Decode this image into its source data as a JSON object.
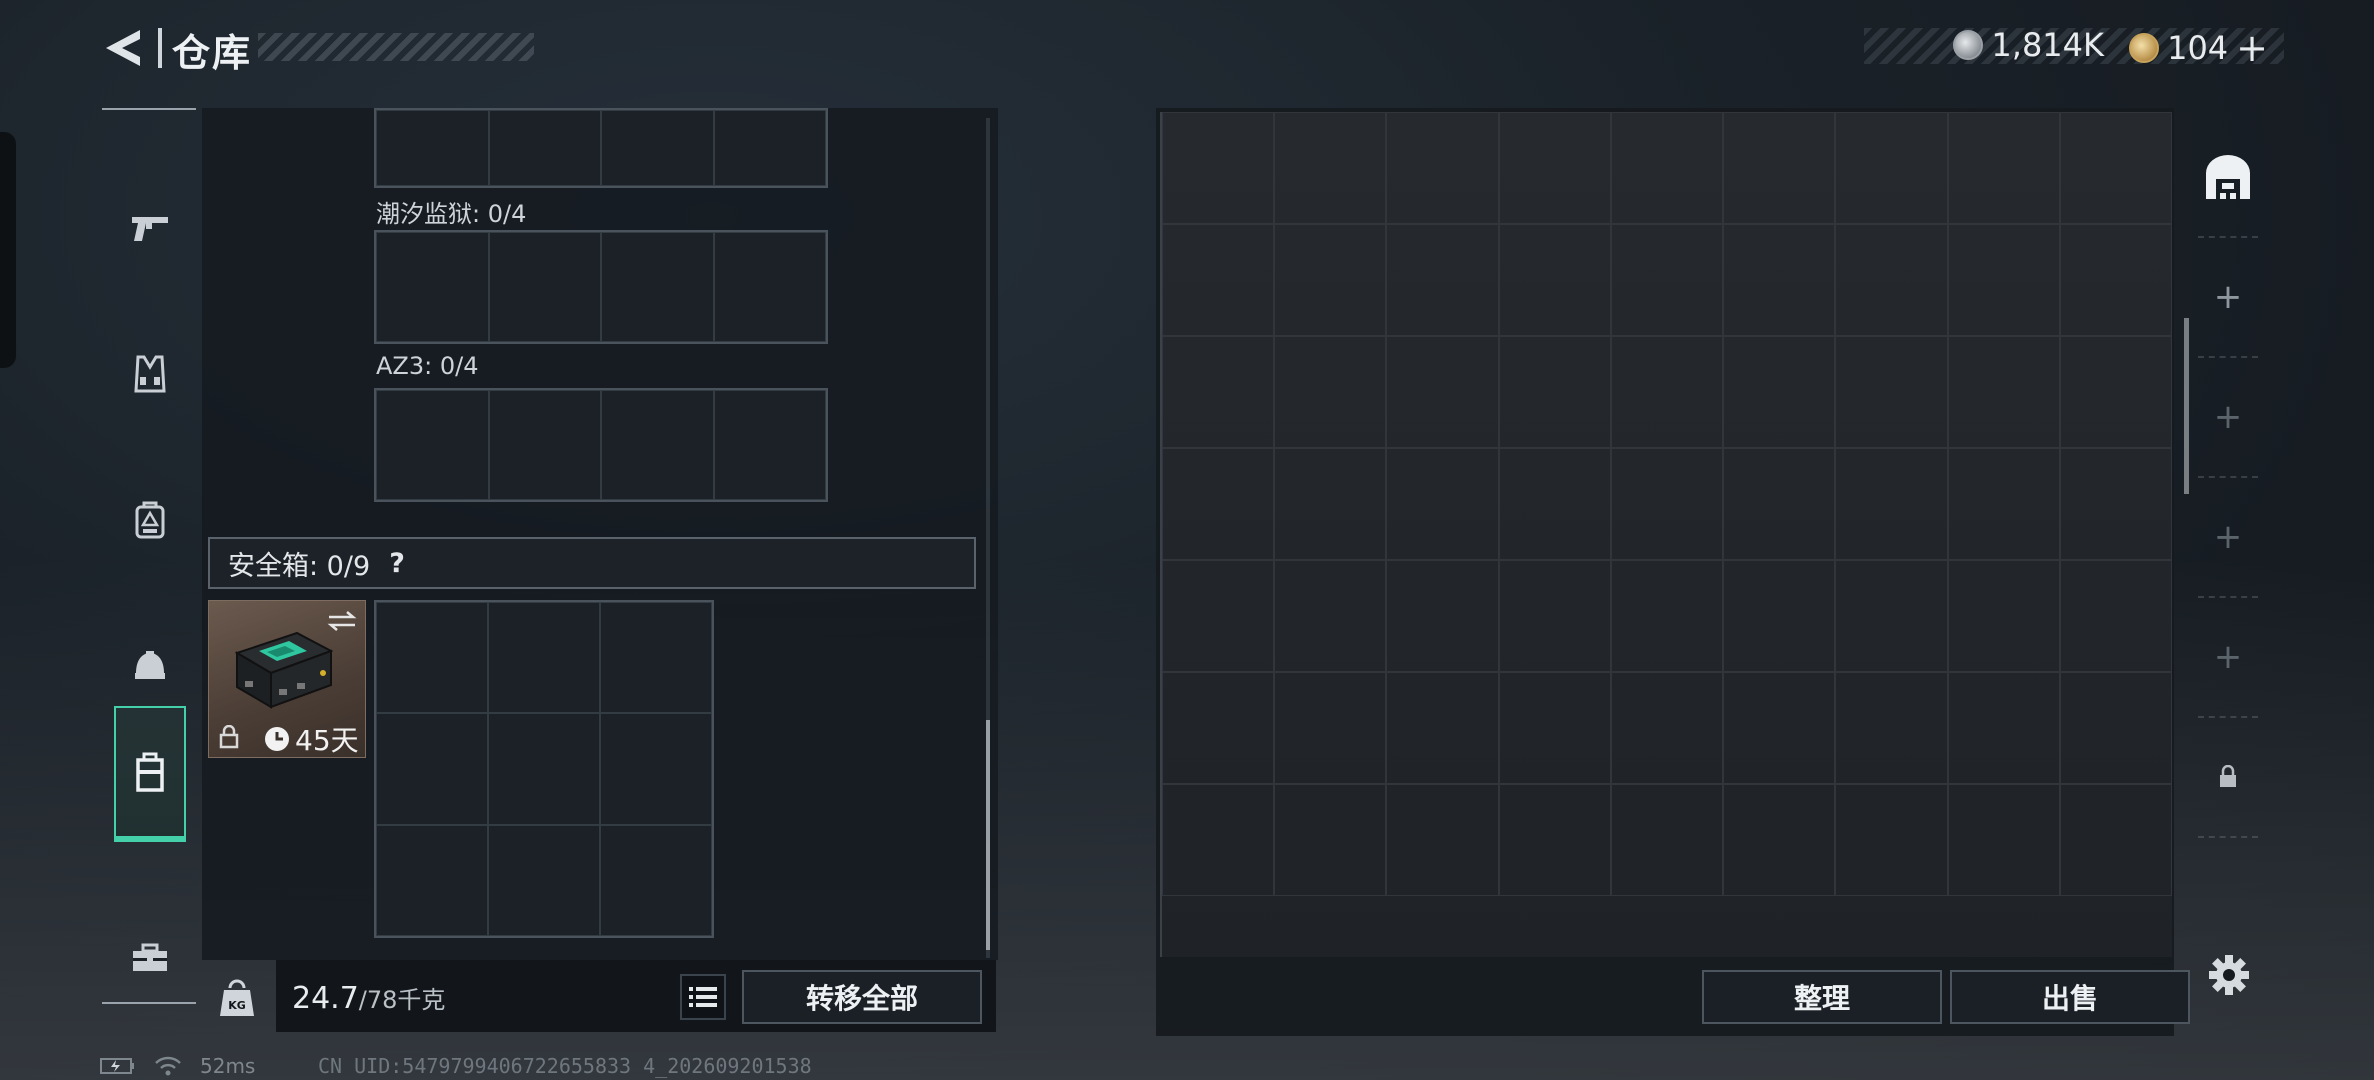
{
  "header": {
    "title": "仓库",
    "currencies": [
      {
        "icon": "silver-coin-icon",
        "value": "1,814K"
      },
      {
        "icon": "gold-coin-icon",
        "value": "104"
      }
    ],
    "add_label": "+"
  },
  "left_nav": {
    "items": [
      {
        "name": "weapon",
        "icon": "pistol-icon"
      },
      {
        "name": "armor",
        "icon": "vest-icon"
      },
      {
        "name": "backpack",
        "icon": "backpack-icon"
      },
      {
        "name": "helmet",
        "icon": "helmet-icon"
      },
      {
        "name": "safebox",
        "icon": "case-icon",
        "active": true
      },
      {
        "name": "toolbox",
        "icon": "toolbox-icon"
      }
    ]
  },
  "slots": [
    {
      "label": "潮汐监狱: 0/4"
    },
    {
      "label": "AZ3: 0/4"
    }
  ],
  "safebox": {
    "label": "安全箱: 0/9",
    "help": "?",
    "item": {
      "days": "45天",
      "icon": "secure-case-icon"
    }
  },
  "footer": {
    "weight_current": "24.7",
    "weight_max": "/78千克",
    "transfer_all": "转移全部",
    "sort": "整理",
    "sell": "出售"
  },
  "status": {
    "ping": "52ms",
    "uid": "CN UID:5479799406722655833 4_202609201538"
  }
}
